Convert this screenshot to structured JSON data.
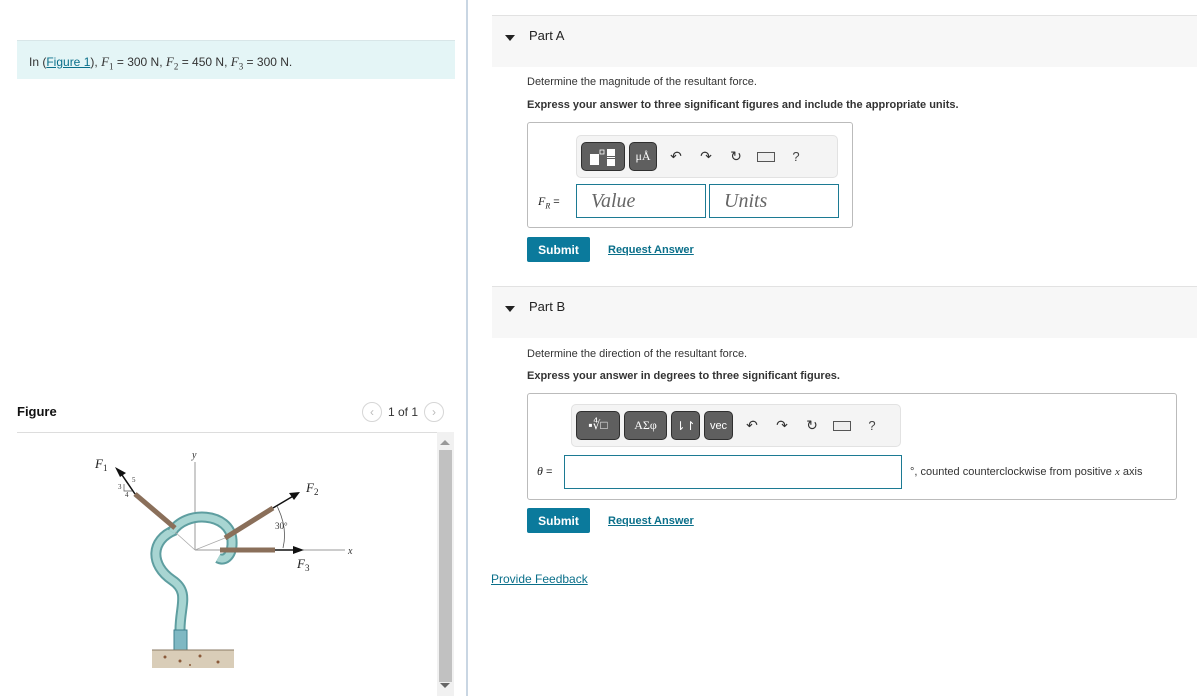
{
  "intro": {
    "prefix": "In (",
    "figure_link": "Figure 1",
    "suffix": "),",
    "forces": [
      {
        "symbol": "F",
        "sub": "1",
        "value": "= 300 N,"
      },
      {
        "symbol": "F",
        "sub": "2",
        "value": "= 450 N,"
      },
      {
        "symbol": "F",
        "sub": "3",
        "value": "= 300 N."
      }
    ]
  },
  "figure": {
    "title": "Figure",
    "pager_text": "1 of 1",
    "labels": {
      "f1": "F",
      "f1_sub": "1",
      "f2": "F",
      "f2_sub": "2",
      "f3": "F",
      "f3_sub": "3",
      "y": "y",
      "x": "x",
      "angle": "30°",
      "slope_3": "3",
      "slope_4": "4",
      "slope_5": "5"
    }
  },
  "parts": [
    {
      "label": "Part A",
      "question": "Determine the magnitude of the resultant force.",
      "instruction": "Express your answer to three significant figures and include the appropriate units.",
      "toolbar": {
        "template_btn": "▪▫",
        "units_btn": "μÅ",
        "help": "?"
      },
      "variable": {
        "symbol": "F",
        "sub": "R",
        "eq": " ="
      },
      "value_placeholder": "Value",
      "units_placeholder": "Units",
      "submit": "Submit",
      "request": "Request Answer"
    },
    {
      "label": "Part B",
      "question": "Determine the direction of the resultant force.",
      "instruction": "Express your answer in degrees to three significant figures.",
      "toolbar": {
        "template_btn": "▪∜□",
        "greek_btn": "ΑΣφ",
        "arrows_btn": "⇂↾",
        "vec_btn": "vec",
        "help": "?"
      },
      "variable": {
        "symbol": "θ",
        "eq": " ="
      },
      "value": "",
      "suffix_a": "°, counted counterclockwise from positive ",
      "suffix_x": "x",
      "suffix_b": " axis",
      "submit": "Submit",
      "request": "Request Answer"
    }
  ],
  "feedback": "Provide Feedback"
}
